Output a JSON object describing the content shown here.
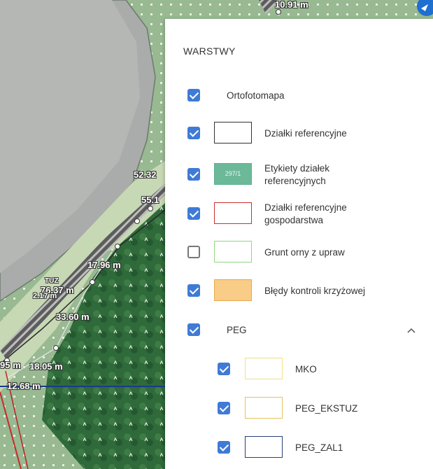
{
  "map": {
    "measurements": [
      "10.91 m",
      "52.32",
      "55.1",
      "17.96 m",
      "TUZ",
      "76.37 m",
      "2.17 m",
      "33.60 m",
      "18.05 m",
      "95 m",
      "12.68 m"
    ],
    "icons": {
      "navigation": "compass-icon"
    }
  },
  "panel": {
    "title": "WARSTWY",
    "layers": [
      {
        "label": "Ortofotomapa",
        "checked": true
      },
      {
        "label": "Działki referencyjne",
        "checked": true,
        "swatch_border": "#333333",
        "swatch_fill": "#ffffff"
      },
      {
        "label": "Etykiety działek referencyjnych",
        "checked": true,
        "swatch_border": "#5aae8c",
        "swatch_fill": "#6cb99a",
        "swatch_text": "297/1"
      },
      {
        "label": "Działki referencyjne gospodarstwa",
        "checked": true,
        "swatch_border": "#cc2f2f",
        "swatch_fill": "#ffffff"
      },
      {
        "label": "Grunt orny z upraw",
        "checked": false,
        "swatch_border": "#8fd882",
        "swatch_fill": "#ffffff"
      },
      {
        "label": "Błędy kontroli krzyżowej",
        "checked": true,
        "swatch_border": "#e6a94f",
        "swatch_fill": "#f9cc88"
      },
      {
        "label": "PEG",
        "checked": true,
        "expanded": true,
        "icon": "chevron-up-icon"
      }
    ],
    "sublayers": [
      {
        "label": "MKO",
        "checked": true,
        "swatch_border": "#f1e089",
        "swatch_fill": "#ffffff"
      },
      {
        "label": "PEG_EKSTUZ",
        "checked": true,
        "swatch_border": "#e6c25a",
        "swatch_fill": "#ffffff"
      },
      {
        "label": "PEG_ZAL1",
        "checked": true,
        "swatch_border": "#2b3f78",
        "swatch_fill": "#ffffff"
      }
    ],
    "colors": {
      "checkbox_active": "#3f7bd6"
    }
  }
}
